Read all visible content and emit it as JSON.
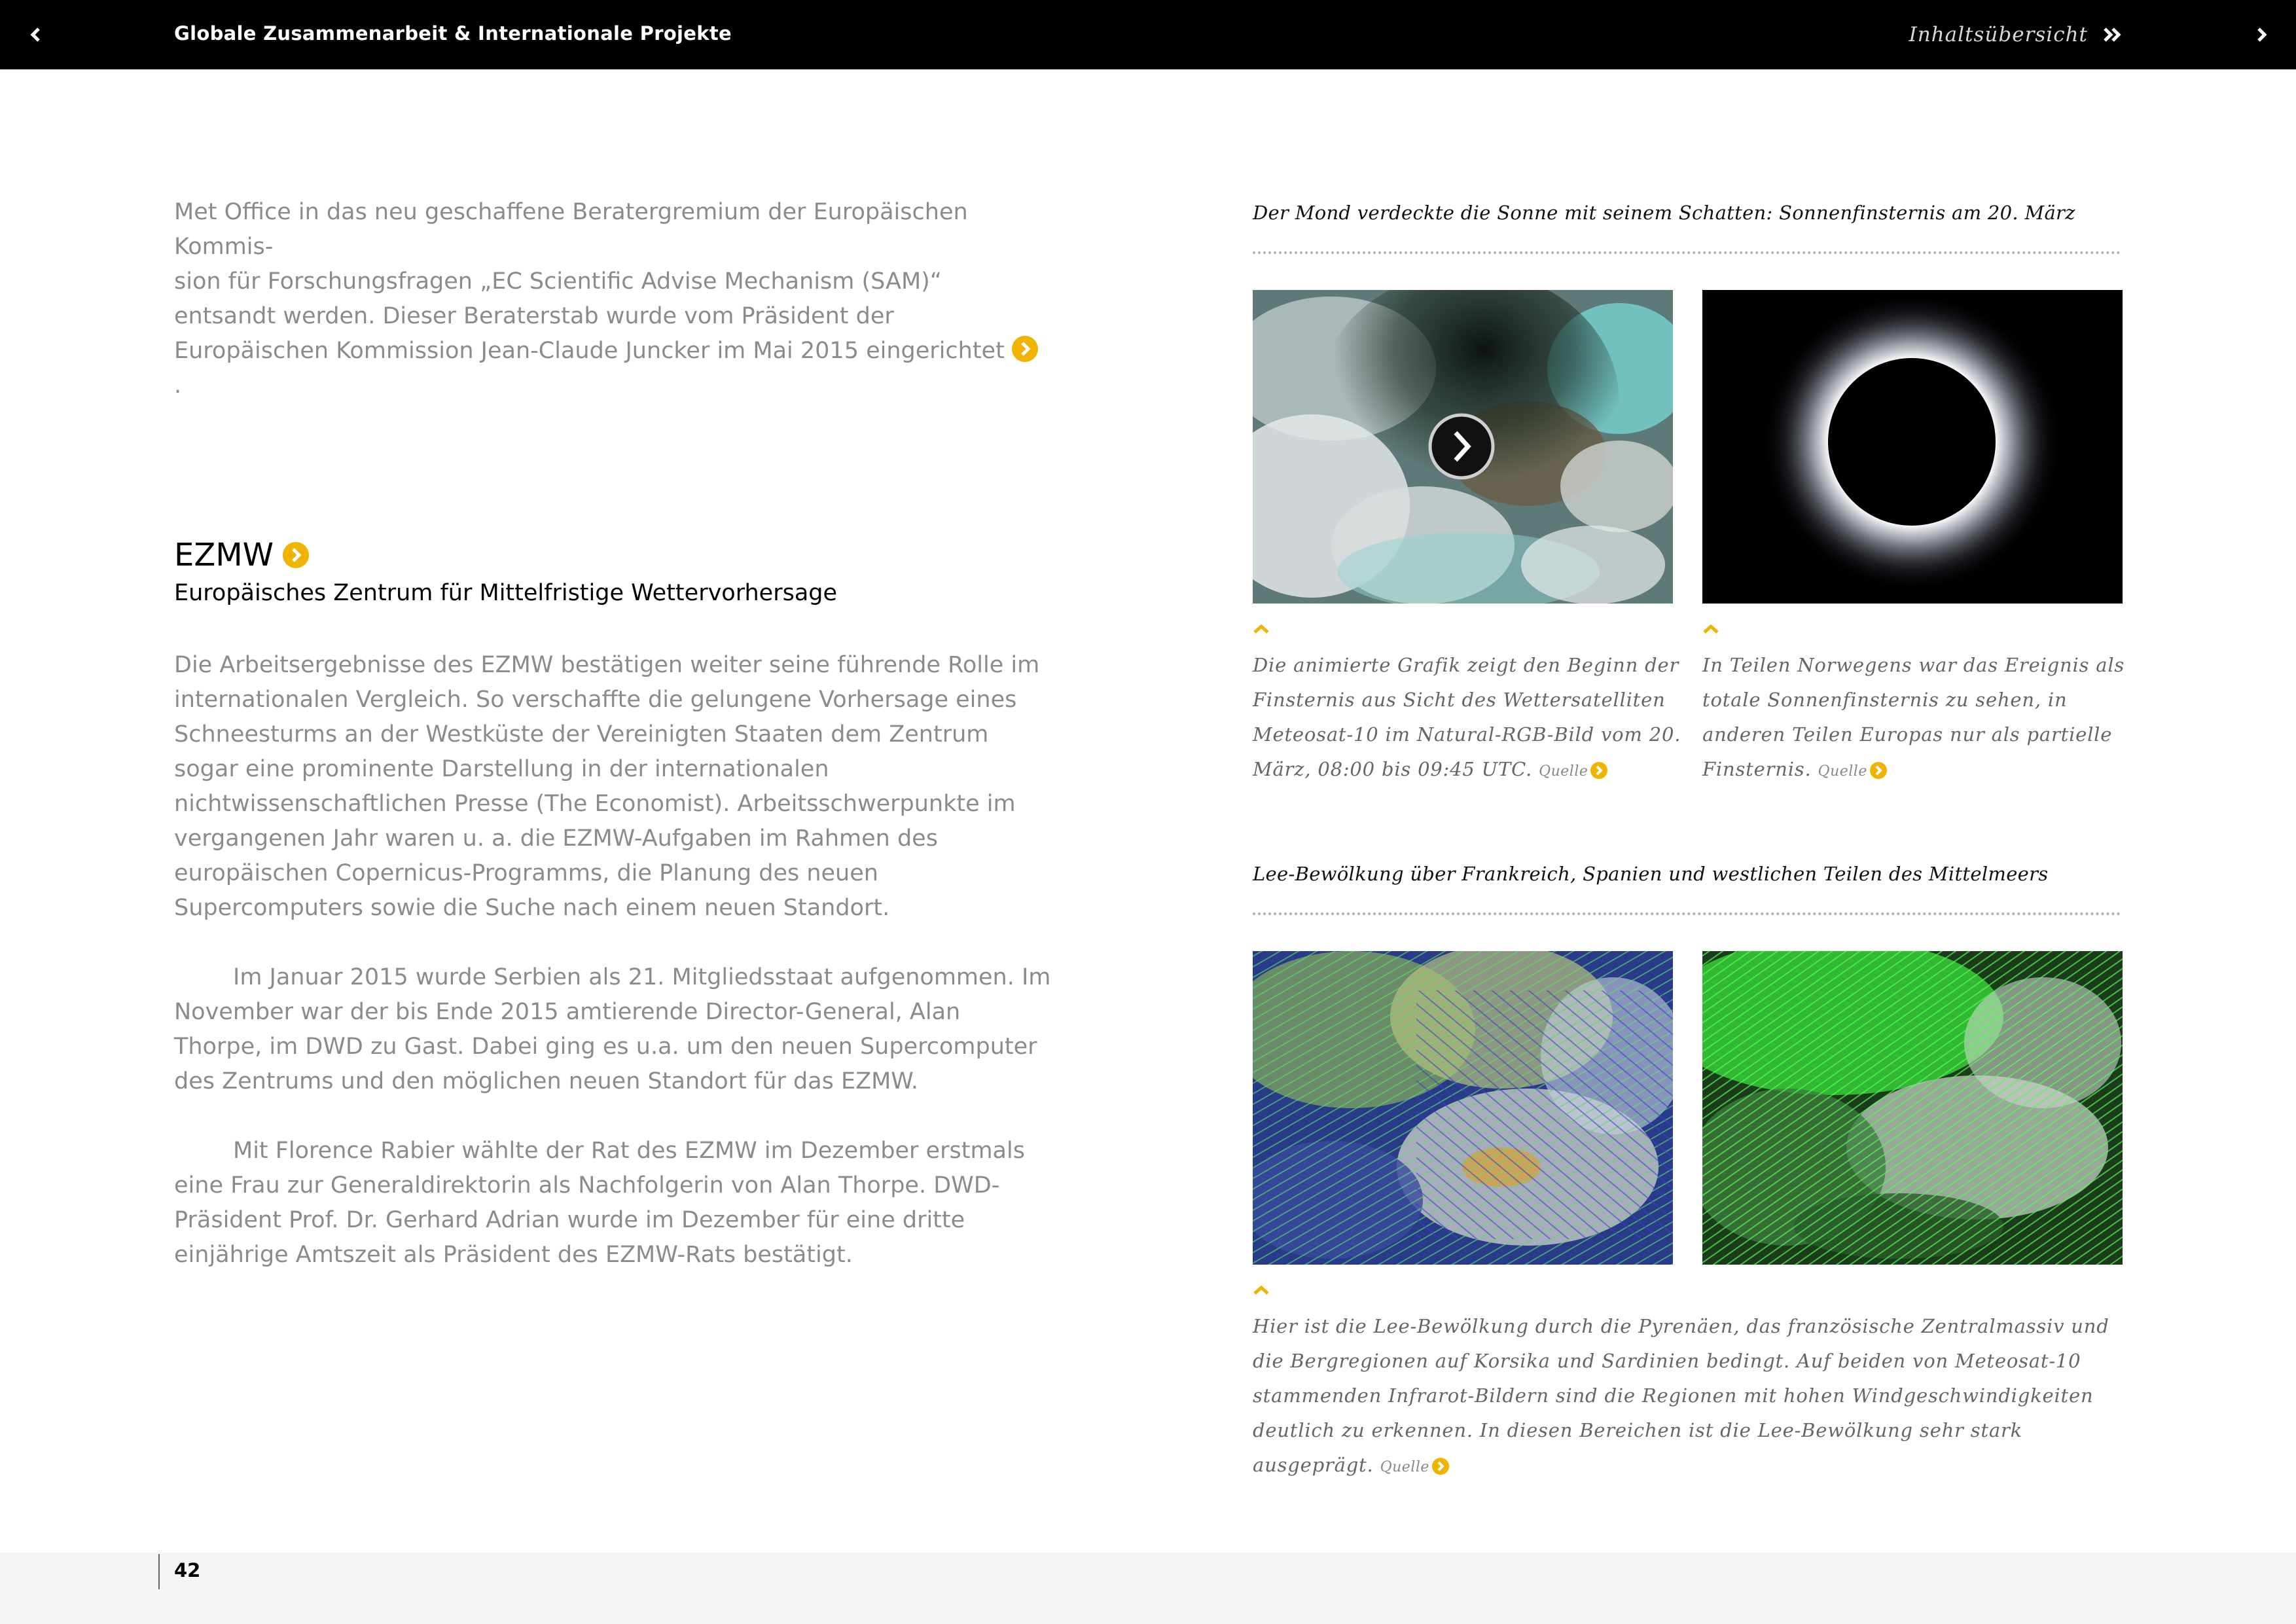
{
  "header": {
    "title": "Globale Zusammenarbeit & Internationale Projekte",
    "toc_label": "Inhaltsübersicht"
  },
  "left": {
    "intro_text": "Met Office in das neu geschaffene Beratergremium der Europäischen Kommis-\nsion für Forschungsfragen „EC Scientific Advise Mechanism (SAM)“ entsandt werden. Dieser Beraterstab wurde vom Präsident der Europäischen Kommission Jean-Claude Juncker im Mai 2015 eingerichtet",
    "ezmw_title": "EZMW",
    "ezmw_subtitle": "Europäisches Zentrum für Mittelfristige Wettervorhersage",
    "paragraph_1": "Die Arbeitsergebnisse des EZMW bestätigen weiter seine führende Rolle im internationalen Vergleich. So verschaffte die gelungene Vorhersage eines Schneesturms an der Westküste der Vereinigten Staaten dem Zentrum sogar eine prominente Darstellung in der internationalen nichtwissenschaftlichen Presse (The Economist). Arbeitsschwerpunkte im vergangenen Jahr waren u. a. die EZMW-Aufgaben im Rahmen des europäischen Copernicus-Programms, die Planung des neuen Supercomputers sowie die Suche nach einem neuen Standort.",
    "paragraph_2": "Im Januar 2015 wurde Serbien als 21. Mitgliedsstaat aufgenommen. Im November war der bis Ende 2015 amtierende Director-General, Alan Thorpe, im DWD zu Gast. Dabei ging es u.a. um den neuen Supercomputer des Zentrums und den möglichen neuen Standort für das EZMW.",
    "paragraph_3": "Mit Florence Rabier wählte der Rat des EZMW im Dezember erstmals eine Frau zur Generaldirektorin als Nachfolgerin von Alan Thorpe. DWD-Präsident Prof. Dr. Gerhard Adrian wurde im Dezember für eine dritte einjährige Amtszeit als Präsident des EZMW-Rats bestätigt."
  },
  "right": {
    "section_1_title": "Der Mond verdeckte die Sonne mit seinem Schatten: Sonnenfinsternis am 20. März",
    "caption_1": "Die animierte Grafik zeigt den Beginn der Finsternis aus Sicht des Wettersatelliten Meteosat-10 im Natural-RGB-Bild vom 20. März, 08:00 bis 09:45 UTC.",
    "caption_2": "In Teilen Norwegens war das Ereignis als totale Sonnenfinsternis zu sehen, in anderen Teilen Europas nur als partielle Finsternis.",
    "section_2_title": "Lee-Bewölkung über Frankreich, Spanien und westlichen Teilen des Mittelmeers",
    "caption_3": "Hier ist die Lee-Bewölkung durch die Pyrenäen, das französische Zentralmassiv und die Bergregionen auf Korsika und Sardinien bedingt. Auf beiden von Meteosat-10 stammenden Infrarot-Bildern sind die Regionen mit hohen Windgeschwindigkeiten deutlich zu erkennen. In diesen Bereichen ist die Lee-Bewölkung sehr stark ausgeprägt.",
    "source_label": "Quelle"
  },
  "footer": {
    "page_number": "42"
  },
  "colors": {
    "accent": "#f0b400",
    "bar": "#000000",
    "body_text": "#8b8b8b"
  }
}
